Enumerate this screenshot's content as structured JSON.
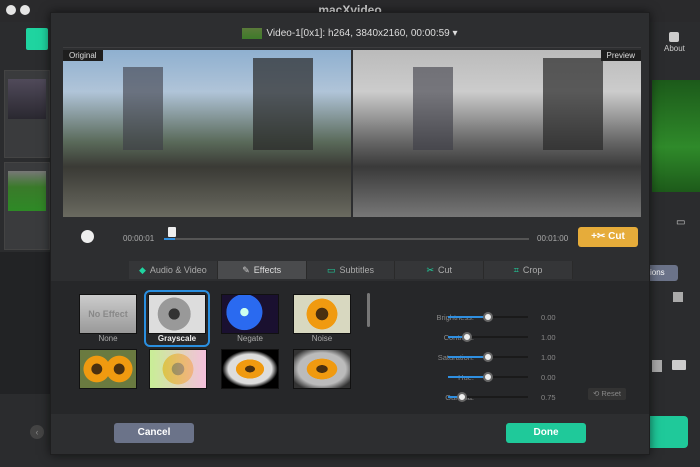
{
  "app": {
    "title": "macXvideo",
    "about": "About"
  },
  "dialog": {
    "video_select": "Video-1[0x1]: h264, 3840x2160, 00:00:59",
    "original_label": "Original",
    "preview_label": "Preview",
    "player": {
      "current_time": "00:00:01",
      "end_time": "00:01:00",
      "progress": 0.03,
      "cut_label": "Cut"
    },
    "tabs": [
      {
        "label": "Audio & Video",
        "icon": "◆"
      },
      {
        "label": "Effects",
        "icon": "✎"
      },
      {
        "label": "Subtitles",
        "icon": "▭"
      },
      {
        "label": "Cut",
        "icon": "✂"
      },
      {
        "label": "Crop",
        "icon": "⌗"
      }
    ],
    "active_tab": "Effects",
    "effects": [
      {
        "label": "None",
        "thumb_text": "No Effect"
      },
      {
        "label": "Grayscale"
      },
      {
        "label": "Negate"
      },
      {
        "label": "Noise"
      },
      {
        "label": ""
      },
      {
        "label": ""
      },
      {
        "label": ""
      },
      {
        "label": ""
      }
    ],
    "selected_effect": "Grayscale",
    "sliders": [
      {
        "label": "Brightness:",
        "value": "0.00",
        "pos": 0.5
      },
      {
        "label": "Contrast:",
        "value": "1.00",
        "pos": 0.24
      },
      {
        "label": "Saturation:",
        "value": "1.00",
        "pos": 0.5
      },
      {
        "label": "Hue:",
        "value": "0.00",
        "pos": 0.5
      },
      {
        "label": "Gamma:",
        "value": "0.75",
        "pos": 0.18
      }
    ],
    "reset_label": "Reset",
    "cancel_label": "Cancel",
    "done_label": "Done"
  },
  "background": {
    "options_partial": "ions"
  },
  "colors": {
    "accent": "#2f8fe0",
    "cut": "#e6ac3a",
    "done": "#1fc99a",
    "cancel": "#6b7389"
  }
}
